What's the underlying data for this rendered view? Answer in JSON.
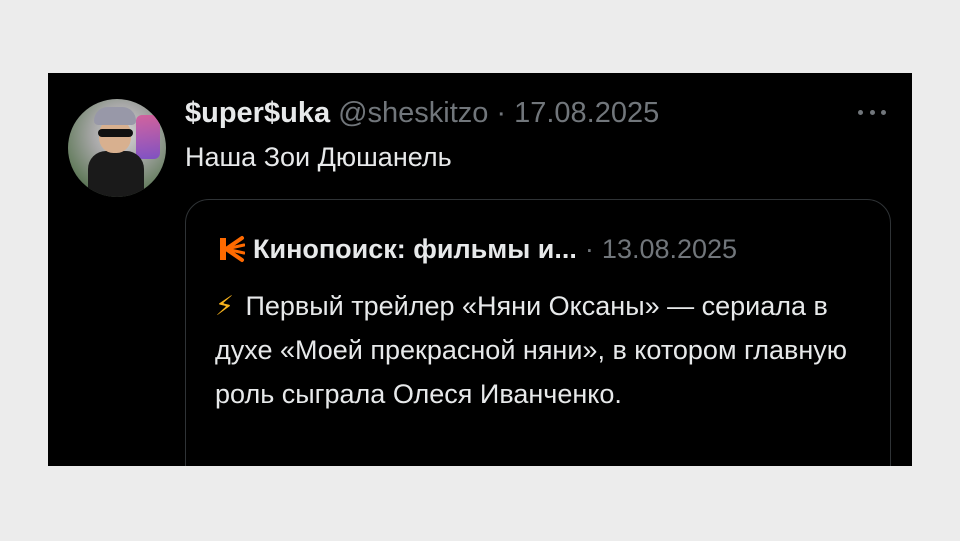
{
  "tweet": {
    "display_name": "$uper$uka",
    "handle": "@sheskitzo",
    "separator": "·",
    "date": "17.08.2025",
    "text": "Наша Зои Дюшанель"
  },
  "quoted": {
    "name": "Кинопоиск: фильмы и...",
    "separator": "·",
    "date": "13.08.2025",
    "emoji": "⚡",
    "text": "Первый трейлер «Няни Оксаны» — сериала в духе «Моей прекрасной няни», в котором главную роль сыграла Олеся Иванченко."
  },
  "icons": {
    "more": "more-options-icon",
    "avatar": "profile-avatar",
    "logo": "kinopoisk-logo-icon"
  },
  "colors": {
    "background": "#ececec",
    "card": "#000000",
    "text": "#e7e9ea",
    "muted": "#71767b",
    "accent": "#ff6a00"
  }
}
